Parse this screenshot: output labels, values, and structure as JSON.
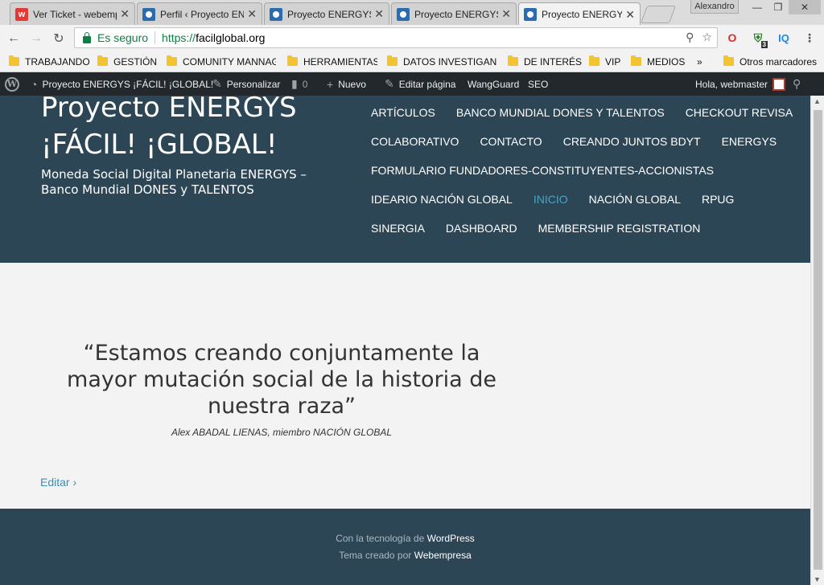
{
  "browser": {
    "tabs": [
      {
        "title": "Ver Ticket - webempresa",
        "icon": "webempresa-icon",
        "active": false
      },
      {
        "title": "Perfil ‹ Proyecto ENERGYS",
        "icon": "wordpress-icon",
        "active": false
      },
      {
        "title": "Proyecto ENERGYS",
        "icon": "wordpress-icon",
        "active": false
      },
      {
        "title": "Proyecto ENERGYS",
        "icon": "wordpress-icon",
        "active": false
      },
      {
        "title": "Proyecto ENERGYS",
        "icon": "wordpress-icon",
        "active": true
      }
    ],
    "user": "Alexandro",
    "omnibox": {
      "secure_label": "Es seguro",
      "url_scheme": "https://",
      "url_host": "facilglobal.org"
    },
    "extensions": {
      "shield_badge": "3",
      "iq_label": "IQ"
    },
    "bookmarks": [
      {
        "label": "TRABAJANDO"
      },
      {
        "label": "GESTIÓN"
      },
      {
        "label": "COMUNITY MANNAGER"
      },
      {
        "label": "HERRAMIENTAS"
      },
      {
        "label": "DATOS INVESTIGANDO"
      },
      {
        "label": "DE INTERÉS"
      },
      {
        "label": "VIP"
      },
      {
        "label": "MEDIOS"
      }
    ],
    "bookmarks_overflow": "»",
    "other_bookmarks": "Otros marcadores"
  },
  "adminbar": {
    "site_name": "Proyecto ENERGYS ¡FÁCIL! ¡GLOBAL!",
    "customize": "Personalizar",
    "comments_count": "0",
    "new": "Nuevo",
    "edit_page": "Editar página",
    "wangguard": "WangGuard",
    "seo": "SEO",
    "greeting": "Hola, webmaster"
  },
  "site": {
    "title_line1": "Proyecto ENERGYS",
    "title_line2": "¡FÁCIL! ¡GLOBAL!",
    "description": "Moneda Social Digital Planetaria ENERGYS – Banco Mundial DONES y TALENTOS",
    "menu_rows": [
      [
        "ARTÍCULOS",
        "BANCO MUNDIAL DONES Y TALENTOS",
        "CHECKOUT REVISA"
      ],
      [
        "COLABORATIVO",
        "CONTACTO",
        "CREANDO JUNTOS BDYT",
        "ENERGYS"
      ],
      [
        "FORMULARIO FUNDADORES-CONSTITUYENTES-ACCIONISTAS"
      ],
      [
        "IDEARIO NACIÓN GLOBAL",
        "INICIO",
        "NACIÓN GLOBAL",
        "RPUG"
      ],
      [
        "SINERGIA",
        "DASHBOARD",
        "MEMBERSHIP REGISTRATION"
      ]
    ],
    "current_menu_item": "INICIO",
    "quote": "“Estamos creando conjuntamente la mayor mutación social de la historia de nuestra raza”",
    "attribution": "Alex ABADAL LIENAS, miembro NACIÓN GLOBAL",
    "edit_link": "Editar ›",
    "footer": {
      "powered_prefix": "Con la tecnología de",
      "powered_link": "WordPress",
      "theme_prefix": "Tema creado por",
      "theme_link": "Webempresa"
    }
  },
  "colors": {
    "header_bg": "#2c4656",
    "adminbar_bg": "#23282d",
    "secure_green": "#0b8043",
    "menu_current": "#4aa3c0",
    "link_blue": "#3e8eb4"
  }
}
